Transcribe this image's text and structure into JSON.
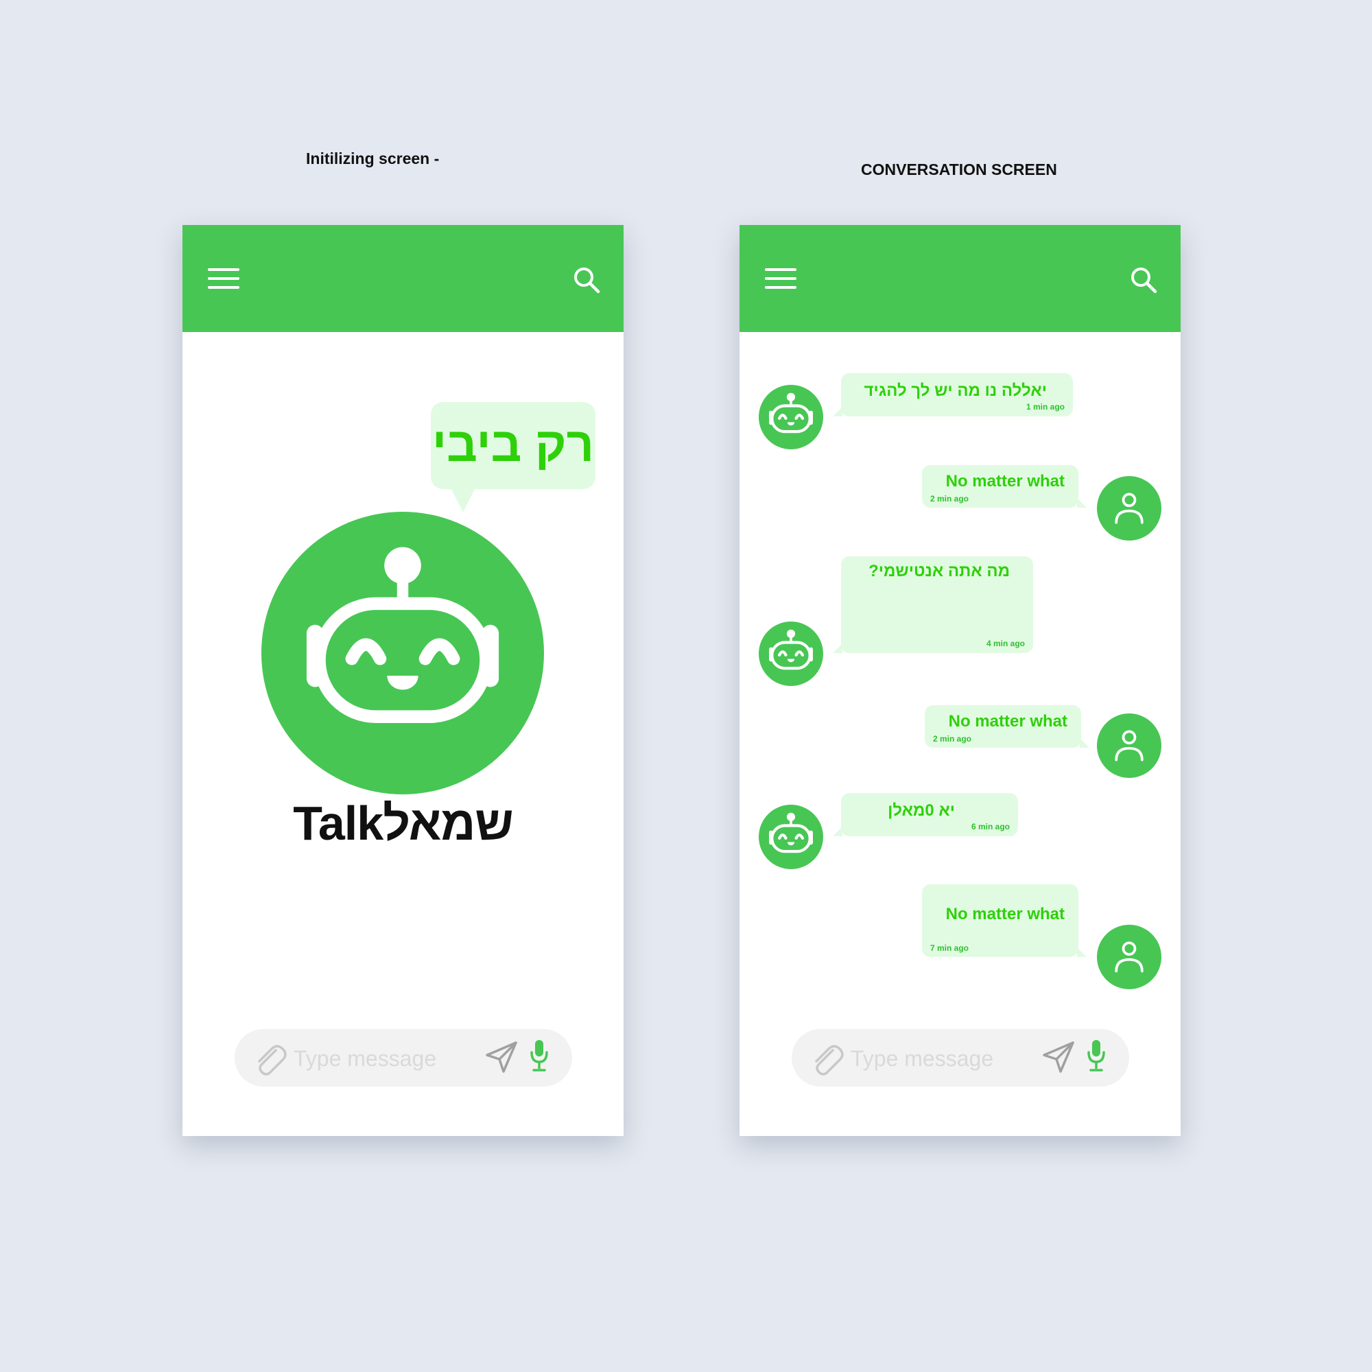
{
  "captions": {
    "left": "Initilizing screen -",
    "right": "CONVERSATION SCREEN"
  },
  "colors": {
    "brand_green": "#47c654",
    "bubble_green": "#e1fbe2",
    "text_green": "#2ed00a",
    "background": "#e4e8f0"
  },
  "icons": {
    "menu": "hamburger-menu-icon",
    "search": "search-icon",
    "attach": "paperclip-icon",
    "send": "send-icon",
    "mic": "microphone-icon",
    "bot": "robot-icon",
    "user": "user-icon"
  },
  "splash": {
    "speech": "רק ביבי",
    "brand": "Talkשמאל"
  },
  "input": {
    "placeholder": "Type message"
  },
  "conversation": {
    "messages": [
      {
        "sender": "bot",
        "text": "יאללה נו מה יש לך להגיד",
        "time": "1 min ago"
      },
      {
        "sender": "user",
        "text": "No matter what",
        "time": "2 min ago"
      },
      {
        "sender": "bot",
        "text": "מה אתה אנטישמי?",
        "time": "4 min ago"
      },
      {
        "sender": "user",
        "text": "No matter what",
        "time": "2 min ago"
      },
      {
        "sender": "bot",
        "text": "יא 0מאלן",
        "time": "6 min ago"
      },
      {
        "sender": "user",
        "text": "No matter what",
        "time": "7 min ago"
      }
    ]
  }
}
